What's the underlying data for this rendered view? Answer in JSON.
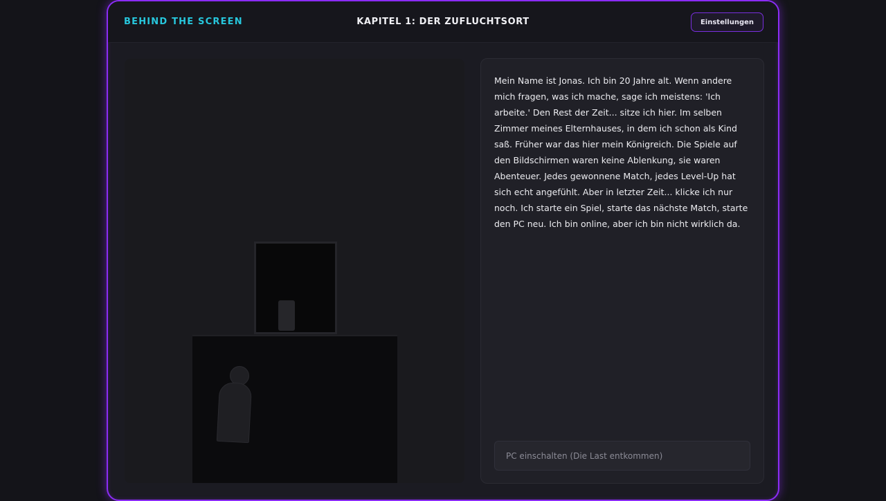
{
  "header": {
    "brand": "BEHIND THE SCREEN",
    "chapter_title": "KAPITEL 1: DER ZUFLUCHTSORT",
    "settings_label": "Einstellungen"
  },
  "story": {
    "text": "Mein Name ist Jonas. Ich bin 20 Jahre alt. Wenn andere mich fragen, was ich mache, sage ich meistens: 'Ich arbeite.' Den Rest der Zeit... sitze ich hier. Im selben Zimmer meines Elternhauses, in dem ich schon als Kind saß. Früher war das hier mein Königreich. Die Spiele auf den Bildschirmen waren keine Ablenkung, sie waren Abenteuer. Jedes gewonnene Match, jedes Level-Up hat sich echt angefühlt. Aber in letzter Zeit... klicke ich nur noch. Ich starte ein Spiel, starte das nächste Match, starte den PC neu. Ich bin online, aber ich bin nicht wirklich da."
  },
  "choices": [
    {
      "label": "PC einschalten (Die Last entkommen)"
    }
  ],
  "colors": {
    "accent_purple": "#8b2cf5",
    "brand_cyan": "#27c6dc",
    "background": "#141419"
  }
}
